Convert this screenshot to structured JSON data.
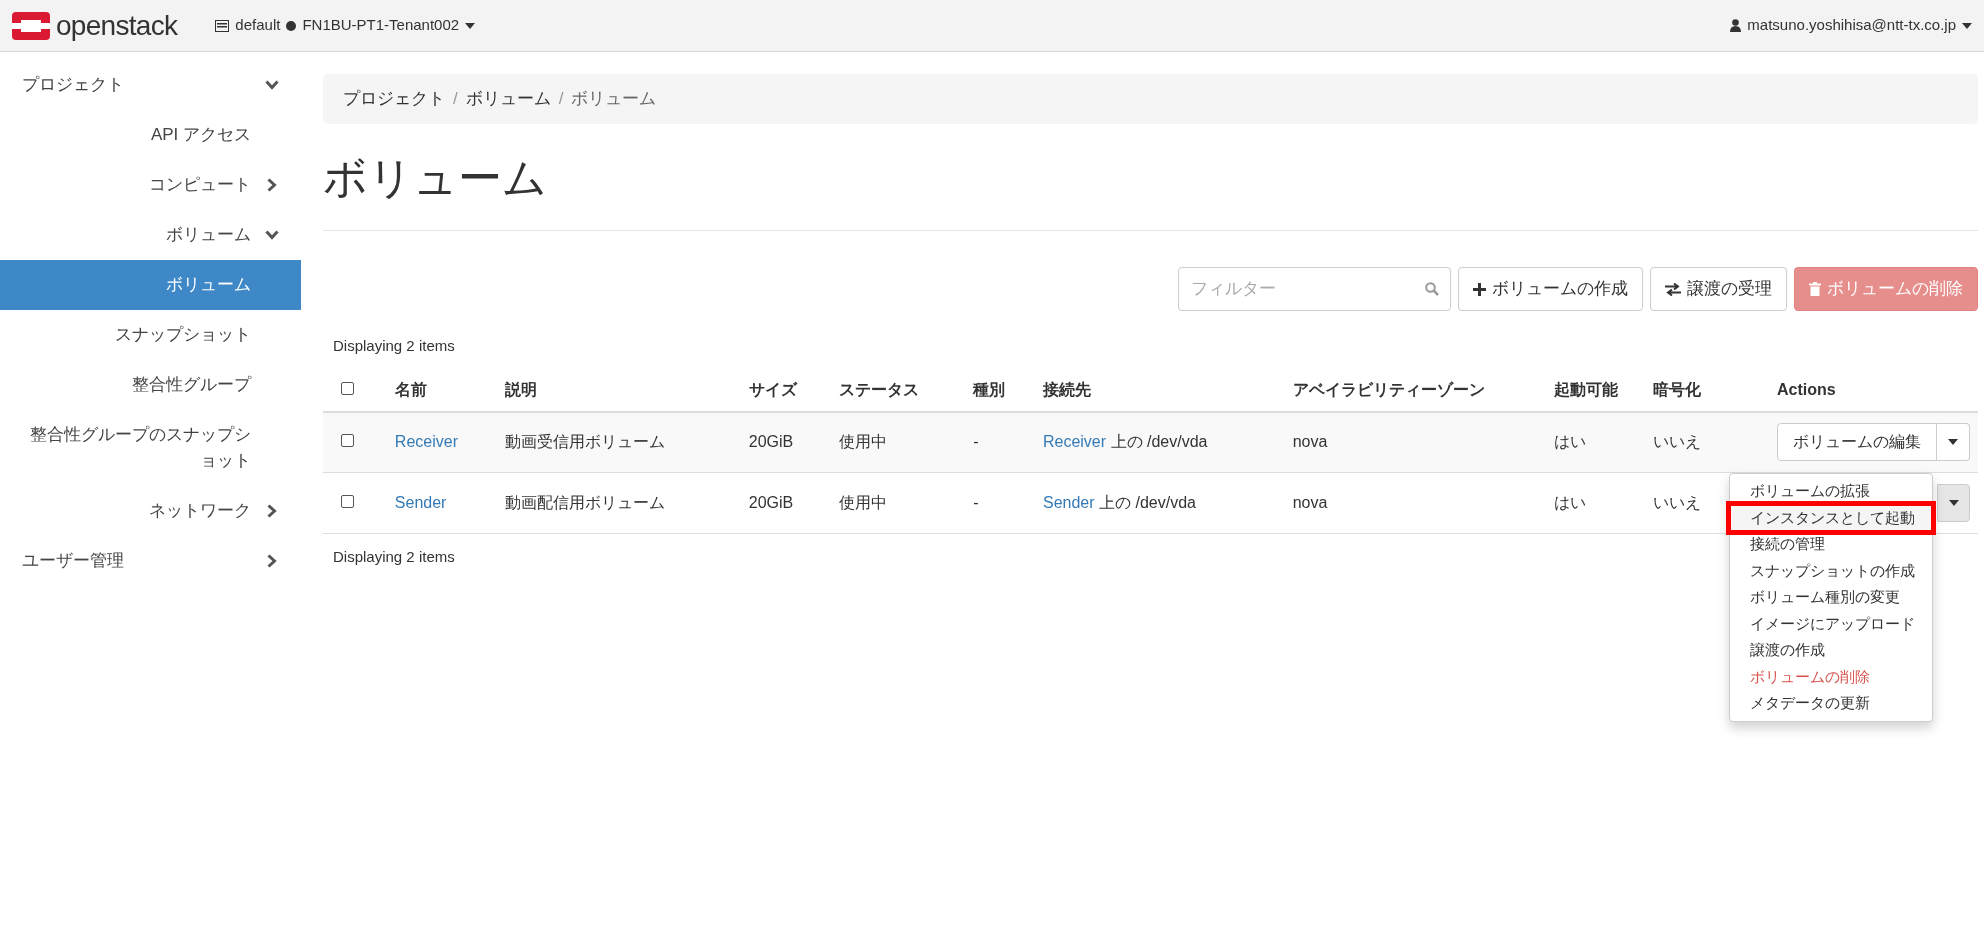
{
  "topbar": {
    "logo": "openstack",
    "project": {
      "domain": "default",
      "name": "FN1BU-PT1-Tenant002"
    },
    "user": "matsuno.yoshihisa@ntt-tx.co.jp"
  },
  "sidebar": {
    "items": [
      {
        "label": "プロジェクト",
        "expanded": true,
        "children": [
          {
            "label": "API アクセス",
            "selected": false
          },
          {
            "label": "コンピュート",
            "expanded": false
          },
          {
            "label": "ボリューム",
            "expanded": true,
            "children": [
              {
                "label": "ボリューム",
                "selected": true
              },
              {
                "label": "スナップショット",
                "selected": false
              },
              {
                "label": "整合性グループ",
                "selected": false
              },
              {
                "label": "整合性グループのスナップショット",
                "selected": false
              }
            ]
          },
          {
            "label": "ネットワーク",
            "expanded": false
          }
        ]
      },
      {
        "label": "ユーザー管理",
        "expanded": false
      }
    ]
  },
  "breadcrumb": {
    "separator": "/",
    "items": [
      "プロジェクト",
      "ボリューム",
      "ボリューム"
    ]
  },
  "title": "ボリューム",
  "toolbar": {
    "filter": {
      "placeholder": "フィルター"
    },
    "buttons": [
      {
        "kind": "create",
        "label": "ボリュームの作成",
        "disabled": false
      },
      {
        "kind": "transfer",
        "label": "譲渡の受理",
        "disabled": false
      },
      {
        "kind": "delete",
        "label": "ボリュームの削除",
        "disabled": true
      }
    ]
  },
  "table": {
    "count_top": "Displaying 2 items",
    "count_bottom": "Displaying 2 items",
    "header_checked": false,
    "columns": [
      "名前",
      "説明",
      "サイズ",
      "ステータス",
      "種別",
      "接続先",
      "アベイラビリティーゾーン",
      "起動可能",
      "暗号化",
      "Actions"
    ],
    "rows": [
      {
        "checked": false,
        "name": "Receiver",
        "description": "動画受信用ボリューム",
        "size": "20GiB",
        "status": "使用中",
        "type": "-",
        "attached_link": "Receiver",
        "attached_rest": "上の /dev/vda",
        "zone": "nova",
        "bootable": "はい",
        "encrypted": "いいえ",
        "action": "ボリュームの編集",
        "menu_open": false
      },
      {
        "checked": false,
        "name": "Sender",
        "description": "動画配信用ボリューム",
        "size": "20GiB",
        "status": "使用中",
        "type": "-",
        "attached_link": "Sender",
        "attached_rest": "上の /dev/vda",
        "zone": "nova",
        "bootable": "はい",
        "encrypted": "いいえ",
        "menu_open": true
      }
    ]
  },
  "action_menu": [
    {
      "label": "ボリュームの拡張",
      "kind": "normal",
      "selected": false
    },
    {
      "label": "インスタンスとして起動",
      "kind": "normal",
      "selected": true
    },
    {
      "label": "接続の管理",
      "kind": "normal",
      "selected": false
    },
    {
      "label": "スナップショットの作成",
      "kind": "normal",
      "selected": false
    },
    {
      "label": "ボリューム種別の変更",
      "kind": "normal",
      "selected": false
    },
    {
      "label": "イメージにアップロード",
      "kind": "normal",
      "selected": false
    },
    {
      "label": "譲渡の作成",
      "kind": "normal",
      "selected": false
    },
    {
      "label": "ボリュームの削除",
      "kind": "danger",
      "selected": false
    },
    {
      "label": "メタデータの更新",
      "kind": "normal",
      "selected": false
    }
  ]
}
